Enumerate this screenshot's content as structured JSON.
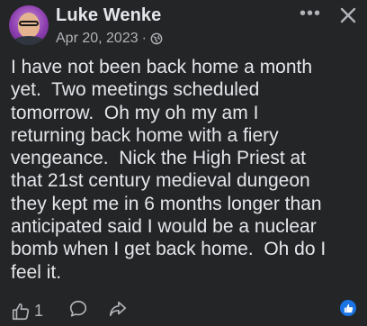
{
  "post": {
    "author": "Luke Wenke",
    "date": "Apr 20, 2023",
    "separator": "·",
    "privacy_icon": "globe-icon",
    "text": "I have not been back home a month\nyet.  Two meetings scheduled\ntomorrow.  Oh my oh my am I\nreturning back home with a fiery\nvengeance.  Nick the High Priest at\nthat 21st century medieval dungeon\nthey kept me in 6 months longer than\nanticipated said I would be a nuclear\nbomb when I get back home.  Oh do I\nfeel it."
  },
  "header": {
    "more_label": "•••",
    "more_icon": "more-options-icon",
    "close_icon": "close-icon"
  },
  "footer": {
    "like_count": "1",
    "like_icon": "thumbs-up-icon",
    "comment_icon": "comment-icon",
    "share_icon": "share-icon",
    "reaction_icon": "like-reaction-icon"
  },
  "colors": {
    "background": "#242526",
    "text_primary": "#e4e6eb",
    "text_secondary": "#b0b3b8",
    "accent": "#1b74e4"
  }
}
